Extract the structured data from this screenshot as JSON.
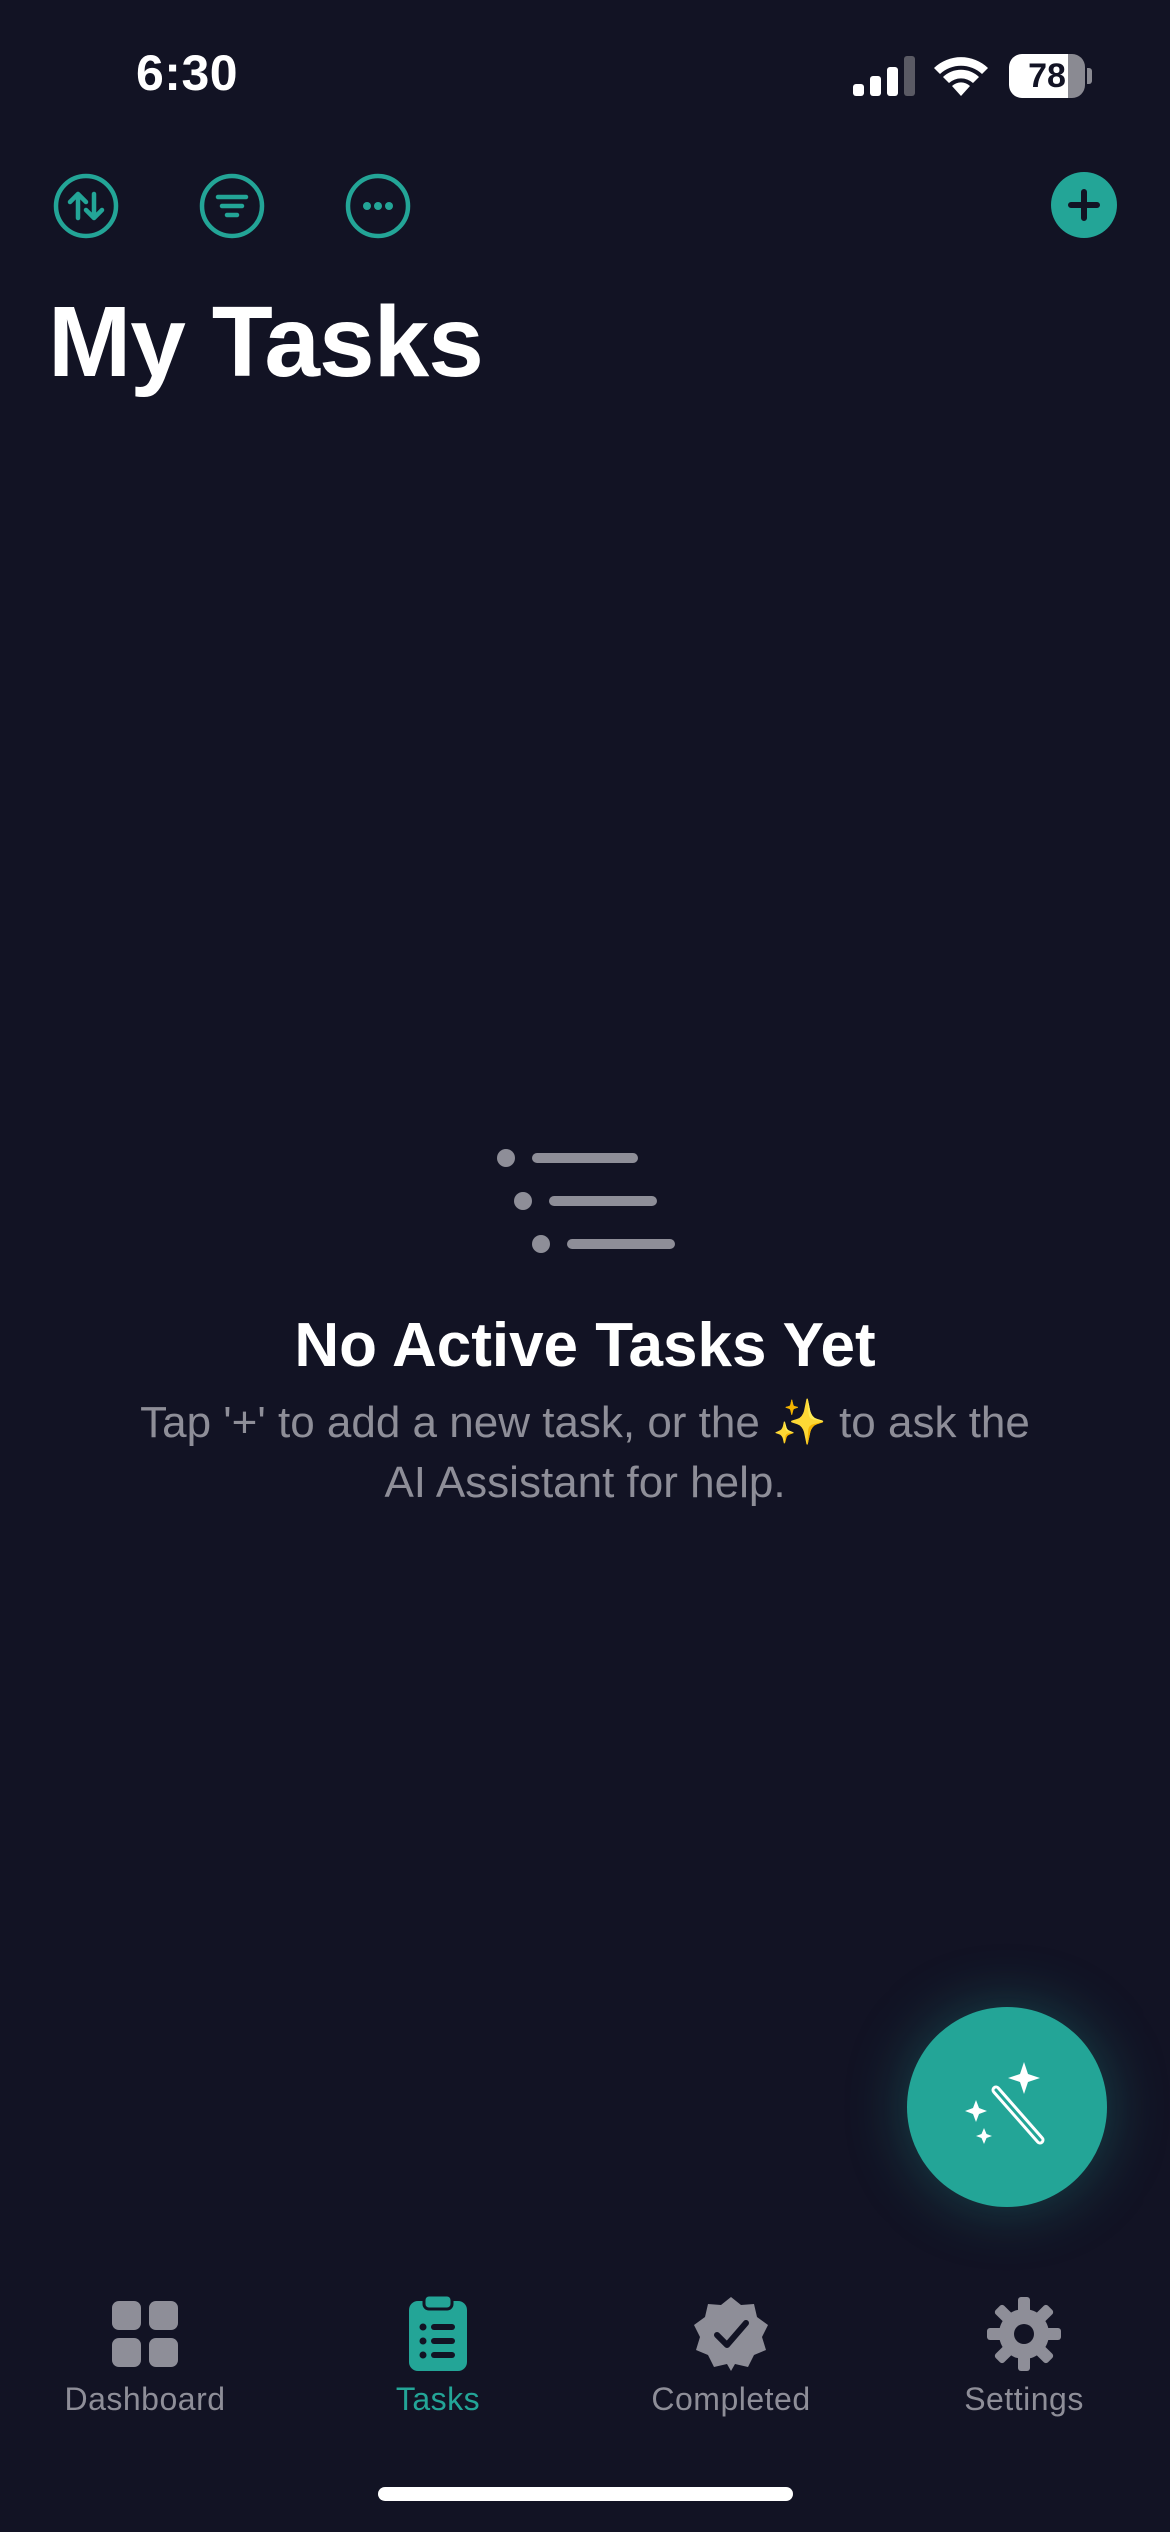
{
  "status_bar": {
    "time": "6:30",
    "battery_level": "78",
    "battery_fraction": 0.78,
    "icons": [
      "cellular-signal-icon",
      "wifi-icon",
      "battery-icon"
    ]
  },
  "toolbar": {
    "icons": [
      "sort-icon",
      "filter-icon",
      "more-icon",
      "plus-icon"
    ]
  },
  "header": {
    "title": "My Tasks"
  },
  "empty_state": {
    "icon": "list-icon",
    "title": "No Active Tasks Yet",
    "subtitle": "Tap '+' to add a new task, or the ✨ to ask the AI Assistant for help."
  },
  "fab": {
    "icon": "magic-wand-sparkles-icon"
  },
  "tab_bar": {
    "tabs": [
      {
        "label": "Dashboard",
        "icon": "dashboard-grid-icon",
        "active": false
      },
      {
        "label": "Tasks",
        "icon": "clipboard-list-icon",
        "active": true
      },
      {
        "label": "Completed",
        "icon": "checkmark-badge-icon",
        "active": false
      },
      {
        "label": "Settings",
        "icon": "gear-icon",
        "active": false
      }
    ]
  },
  "colors": {
    "background": "#121324",
    "accent": "#23a597",
    "secondary_text": "#8e8e98",
    "primary_text": "#ffffff"
  }
}
